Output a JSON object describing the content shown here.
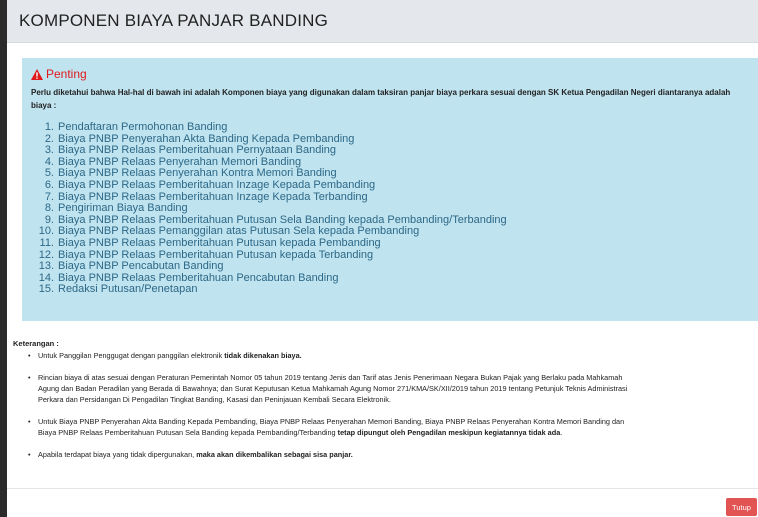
{
  "header": {
    "title": "KOMPONEN BIAYA PANJAR BANDING"
  },
  "alert": {
    "icon": "warning-icon",
    "title": "Penting",
    "description": "Perlu diketahui bahwa Hal-hal di bawah ini adalah Komponen biaya yang digunakan dalam taksiran panjar biaya perkara sesuai dengan SK Ketua Pengadilan Negeri diantaranya adalah biaya :",
    "items": [
      {
        "num": "1.",
        "label": "Pendaftaran Permohonan Banding"
      },
      {
        "num": "2.",
        "label": "Biaya PNBP Penyerahan Akta Banding Kepada Pembanding"
      },
      {
        "num": "3.",
        "label": "Biaya PNBP Relaas Pemberitahuan Pernyataan Banding"
      },
      {
        "num": "4.",
        "label": "Biaya PNBP Relaas Penyerahan Memori Banding"
      },
      {
        "num": "5.",
        "label": "Biaya PNBP Relaas Penyerahan Kontra Memori Banding"
      },
      {
        "num": "6.",
        "label": "Biaya PNBP Relaas Pemberitahuan Inzage Kepada Pembanding"
      },
      {
        "num": "7.",
        "label": "Biaya PNBP Relaas Pemberitahuan Inzage Kepada Terbanding"
      },
      {
        "num": "8.",
        "label": "Pengiriman Biaya Banding"
      },
      {
        "num": "9.",
        "label": "Biaya PNBP Relaas Pemberitahuan Putusan Sela Banding kepada Pembanding/Terbanding"
      },
      {
        "num": "10.",
        "label": "Biaya PNBP Relaas Pemanggilan atas Putusan Sela kepada Pembanding"
      },
      {
        "num": "11.",
        "label": "Biaya PNBP Relaas Pemberitahuan Putusan kepada Pembanding"
      },
      {
        "num": "12.",
        "label": "Biaya PNBP Relaas Pemberitahuan Putusan kepada Terbanding"
      },
      {
        "num": "13.",
        "label": "Biaya PNBP Pencabutan Banding"
      },
      {
        "num": "14.",
        "label": "Biaya PNBP Relaas Pemberitahuan Pencabutan Banding"
      },
      {
        "num": "15.",
        "label": "Redaksi Putusan/Penetapan"
      }
    ]
  },
  "notes": {
    "title": "Keterangan :",
    "bullet": "•",
    "n1": {
      "text": "Untuk Panggilan Penggugat dengan panggilan elektronik ",
      "bold": "tidak dikenakan biaya."
    },
    "n2": {
      "l1": "Rincian biaya di atas sesuai dengan Peraturan Pemerintah Nomor 05 tahun 2019 tentang Jenis dan Tarif atas Jenis Penerimaan Negara Bukan Pajak yang Berlaku pada Mahkamah",
      "l2": "Agung dan Badan Peradilan yang Berada di Bawahnya; dan Surat Keputusan Ketua Mahkamah Agung Nomor 271/KMA/SK/XII/2019 tahun 2019 tentang Petunjuk Teknis Administrasi",
      "l3": "Perkara dan Persidangan Di Pengadilan Tingkat Banding, Kasasi dan Peninjauan Kembali Secara Elektronik."
    },
    "n3": {
      "l1": "Untuk Biaya PNBP Penyerahan Akta Banding Kepada Pembanding, Biaya PNBP Relaas Penyerahan Memori Banding, Biaya PNBP Relaas Penyerahan Kontra Memori Banding dan",
      "l2": "Biaya PNBP Relaas Pemberitahuan Putusan Sela Banding kepada Pembanding/Terbanding ",
      "l2_bold": "tetap dipungut oleh Pengadilan meskipun kegiatannya tidak ada",
      "l2_end": "."
    },
    "n4": {
      "text": "Apabila terdapat biaya yang tidak dipergunakan, ",
      "bold": "maka akan dikembalikan sebagai sisa panjar."
    }
  },
  "footer": {
    "close_label": "Tutup"
  },
  "colors": {
    "alert_bg": "#bfe3ef",
    "alert_title": "#e0191b",
    "list_text": "#2d6887",
    "close_button": "#e25353",
    "header_bg": "#e4e7eb"
  }
}
